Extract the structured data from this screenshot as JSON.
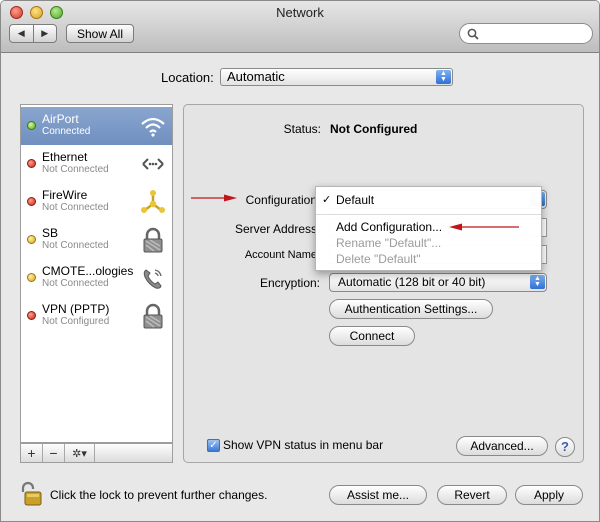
{
  "window": {
    "title": "Network"
  },
  "toolbar": {
    "back_glyph": "◀",
    "forward_glyph": "▶",
    "show_all_label": "Show All"
  },
  "location": {
    "label": "Location:",
    "value": "Automatic"
  },
  "services": [
    {
      "name": "AirPort",
      "status": "Connected",
      "dot": "green",
      "icon": "wifi-icon"
    },
    {
      "name": "Ethernet",
      "status": "Not Connected",
      "dot": "red",
      "icon": "ethernet-icon"
    },
    {
      "name": "FireWire",
      "status": "Not Connected",
      "dot": "red",
      "icon": "firewire-icon"
    },
    {
      "name": "SB",
      "status": "Not Connected",
      "dot": "yellow",
      "icon": "lock-icon"
    },
    {
      "name": "CMOTE...ologies",
      "status": "Not Connected",
      "dot": "yellow",
      "icon": "phone-icon"
    },
    {
      "name": "VPN (PPTP)",
      "status": "Not Configured",
      "dot": "red",
      "icon": "lock-icon"
    }
  ],
  "sidebar_tools": {
    "add": "+",
    "remove": "−",
    "gear": "✲▾"
  },
  "detail": {
    "status_label": "Status:",
    "status_value": "Not Configured",
    "configuration_label": "Configuration",
    "server_address_label": "Server Address",
    "account_name_label": "Account Name",
    "encryption_label": "Encryption:",
    "encryption_value": "Automatic (128 bit or 40 bit)",
    "auth_button": "Authentication Settings...",
    "connect_button": "Connect",
    "show_vpn_label": "Show VPN status in menu bar",
    "advanced_button": "Advanced...",
    "help_glyph": "?"
  },
  "config_menu": {
    "selected": "Default",
    "check": "✓",
    "items": [
      {
        "label": "Add Configuration...",
        "enabled": true
      },
      {
        "label": "Rename \"Default\"...",
        "enabled": false
      },
      {
        "label": "Delete \"Default\"",
        "enabled": false
      }
    ]
  },
  "footer": {
    "lock_text": "Click the lock to prevent further changes.",
    "assist_button": "Assist me...",
    "revert_button": "Revert",
    "apply_button": "Apply"
  },
  "colors": {
    "selection": "#7c99c6",
    "accent": "#3b79d8",
    "annotation_arrow": "#c0161b"
  }
}
